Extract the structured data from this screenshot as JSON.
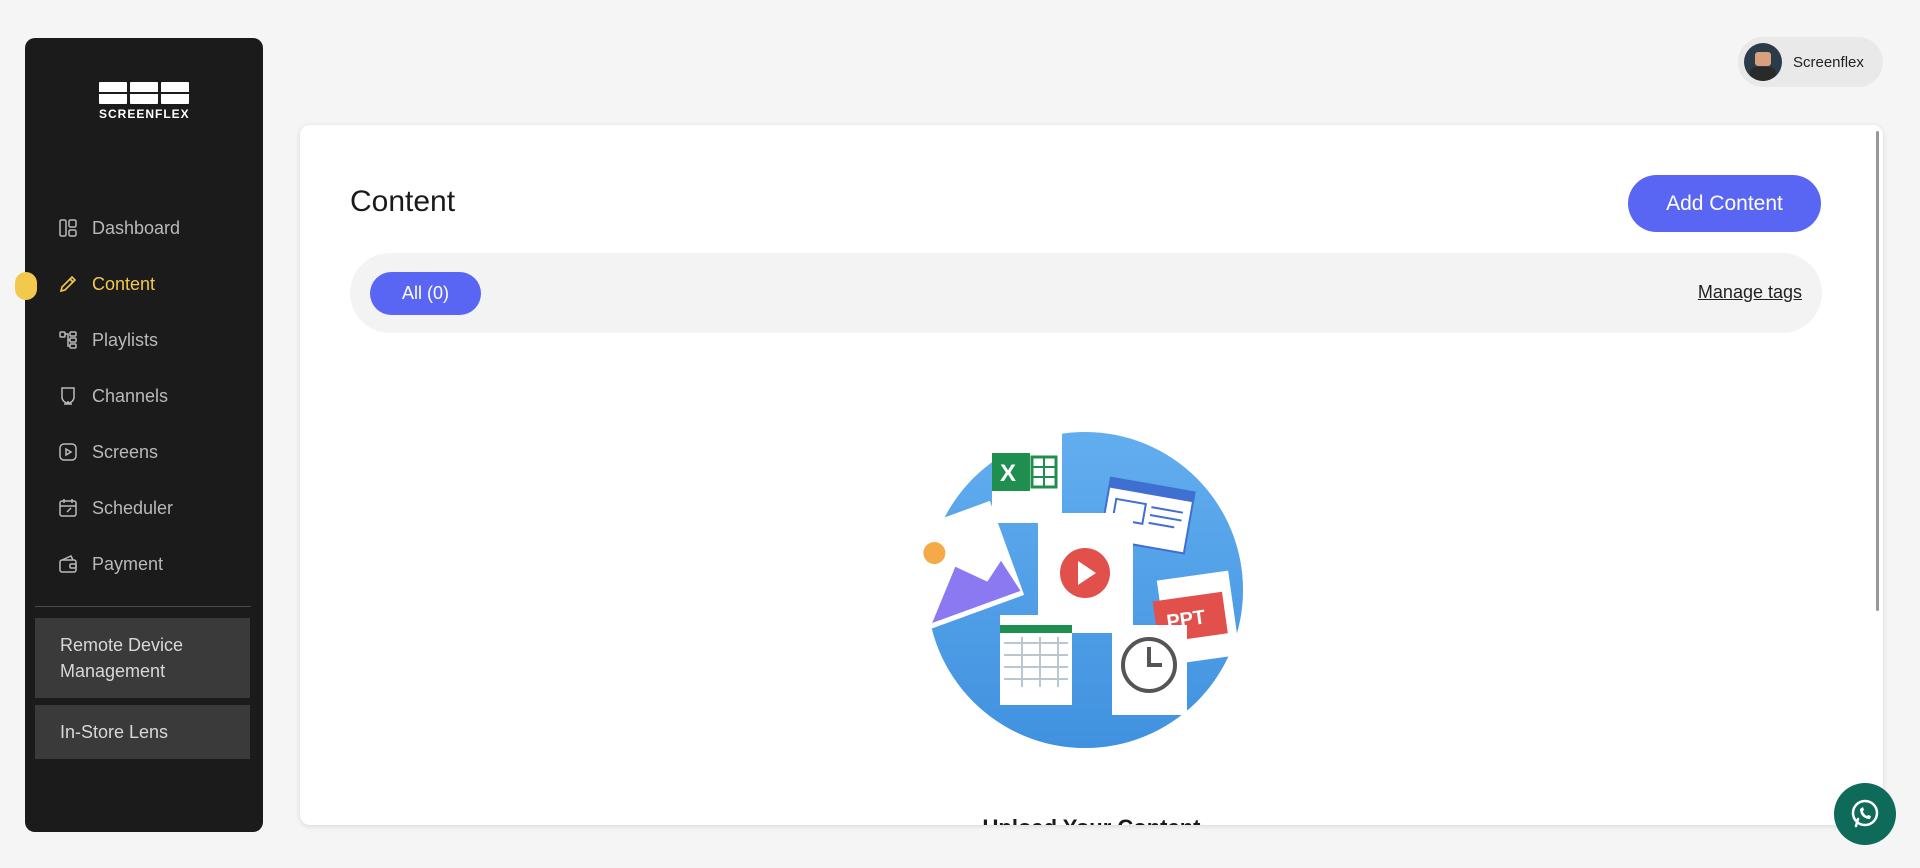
{
  "brand": {
    "logo_text": "SCREENFLEX"
  },
  "sidebar": {
    "items": [
      {
        "label": "Dashboard",
        "icon": "dashboard-icon",
        "active": false
      },
      {
        "label": "Content",
        "icon": "pencil-icon",
        "active": true
      },
      {
        "label": "Playlists",
        "icon": "playlist-icon",
        "active": false
      },
      {
        "label": "Channels",
        "icon": "channel-icon",
        "active": false
      },
      {
        "label": "Screens",
        "icon": "screen-icon",
        "active": false
      },
      {
        "label": "Scheduler",
        "icon": "calendar-icon",
        "active": false
      },
      {
        "label": "Payment",
        "icon": "wallet-icon",
        "active": false
      }
    ],
    "cards": {
      "remote": "Remote Device Management",
      "lens": "In-Store Lens"
    }
  },
  "user": {
    "name": "Screenflex"
  },
  "main": {
    "title": "Content",
    "add_button": "Add Content",
    "filters": {
      "all_label": "All (0)",
      "manage_tags": "Manage tags"
    },
    "empty_title": "Upload Your Content"
  },
  "colors": {
    "accent": "#5965f3",
    "active_nav": "#f2c94c",
    "sidebar_bg": "#1b1b1b",
    "whatsapp": "#0e6b5a"
  }
}
